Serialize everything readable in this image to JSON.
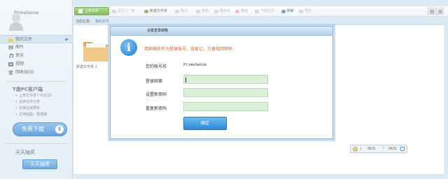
{
  "sidebar": {
    "username": "PrimeSense",
    "nav": [
      {
        "label": "我的文件",
        "icon": "folder-icon",
        "active": true
      },
      {
        "label": "图片",
        "icon": "image-icon"
      },
      {
        "label": "音乐",
        "icon": "music-icon"
      },
      {
        "label": "视频",
        "icon": "video-icon"
      },
      {
        "label": "回收站(0)",
        "icon": "trash-icon"
      }
    ],
    "pc_client": {
      "title": "T盘PC客户端",
      "features": [
        "上传文件单个可达2G",
        "支持文件分享",
        "支持在线预览",
        "支持粘贴，更便捷"
      ],
      "download_label": "免费下载"
    },
    "lottery": {
      "title": "天天抽奖",
      "button": "天天抽奖"
    }
  },
  "toolbar": {
    "upload": "上传文件",
    "items": [
      {
        "label": "返回上一级",
        "enabled": false
      },
      {
        "label": "新建文件夹",
        "enabled": true
      },
      {
        "label": "移动",
        "enabled": false
      },
      {
        "label": "复制",
        "enabled": false
      },
      {
        "label": "重命名",
        "enabled": false
      },
      {
        "label": "删除",
        "enabled": false
      },
      {
        "label": "下载文件",
        "enabled": false
      },
      {
        "label": "刷新",
        "enabled": true
      },
      {
        "label": "预览",
        "enabled": false
      }
    ]
  },
  "breadcrumb": {
    "prefix": "当前位置：",
    "current": "我的文件"
  },
  "files": [
    {
      "name": "新建文件夹 1"
    }
  ],
  "transfer": {
    "down": "0K/S",
    "up": "0K/S"
  },
  "modal": {
    "title": "设置登录邮箱",
    "notice": "用邮箱名作为登录账号，容易记，方便找回密码",
    "account_label": "您的帐号名",
    "account_value": "PrimeSense",
    "email_label": "登录邮箱",
    "email_value": "",
    "password_label": "设置新密码",
    "password_value": "",
    "repeat_label": "重复新密码",
    "repeat_value": "",
    "confirm": "确定"
  },
  "colors": {
    "accent": "#2c88d6",
    "notice": "#d4622a",
    "field": "#d9f0d9",
    "upload": "#5aa22c"
  }
}
